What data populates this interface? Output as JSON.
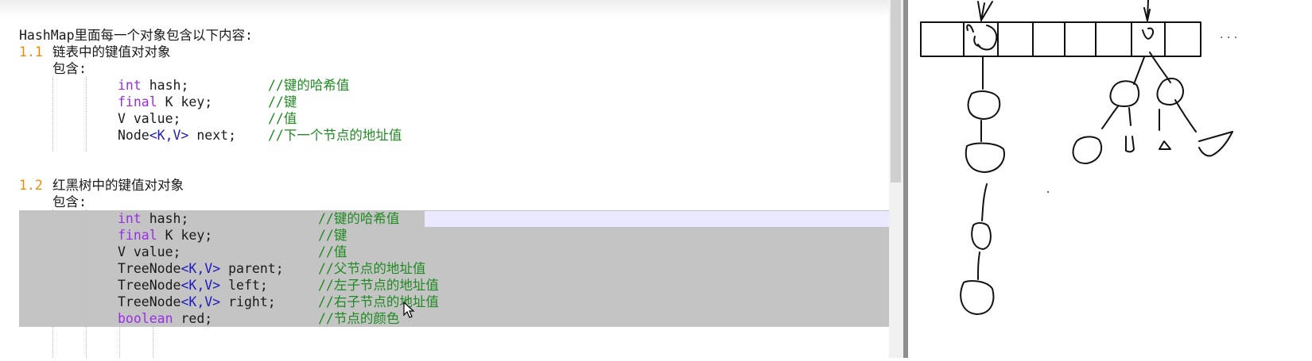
{
  "editor": {
    "lines": {
      "l0": "HashMap里面每一个对象包含以下内容:",
      "s1_num": "1.1",
      "s1_title": "链表中的键值对对象",
      "s1_contains": "包含:",
      "s1_hash_kw": "int",
      "s1_hash_rest": " hash;",
      "s1_hash_cm": "//键的哈希值",
      "s1_key_kw": "final",
      "s1_key_rest": " K key;",
      "s1_key_cm": "//键",
      "s1_val_rest": "V value;",
      "s1_val_cm": "//值",
      "s1_next_a": "Node",
      "s1_next_gen": "<K,V>",
      "s1_next_b": " next;",
      "s1_next_cm": "//下一个节点的地址值",
      "s2_num": "1.2",
      "s2_title": "红黑树中的键值对对象",
      "s2_contains": "包含:",
      "s2_hash_kw": "int",
      "s2_hash_rest": " hash;",
      "s2_hash_cm": "//键的哈希值",
      "s2_key_kw": "final",
      "s2_key_rest": " K key;",
      "s2_key_cm": "//键",
      "s2_val_rest": "V value;",
      "s2_val_cm": "//值",
      "s2_parent_a": "TreeNode",
      "s2_parent_gen": "<K,V>",
      "s2_parent_b": " parent;",
      "s2_parent_cm": "//父节点的地址值",
      "s2_left_a": "TreeNode",
      "s2_left_gen": "<K,V>",
      "s2_left_b": " left;",
      "s2_left_cm": "//左子节点的地址值",
      "s2_right_a": "TreeNode",
      "s2_right_gen": "<K,V>",
      "s2_right_b": " right;",
      "s2_right_cm": "//右子节点的地址值",
      "s2_red_kw": "boolean",
      "s2_red_rest": " red;",
      "s2_red_cm": "//节点的颜色"
    }
  },
  "drawing": {
    "ellipsis": "· · ·",
    "array_cells": 8
  },
  "colors": {
    "keyword": "#9a2ee8",
    "generic": "#1d1db8",
    "comment": "#1f8a22",
    "number": "#f28b00",
    "selection": "#c4c4c4"
  }
}
